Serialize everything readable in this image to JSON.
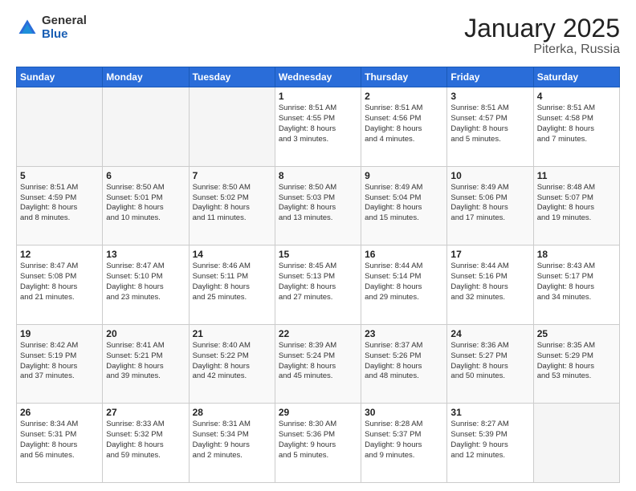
{
  "logo": {
    "general": "General",
    "blue": "Blue"
  },
  "title": {
    "month": "January 2025",
    "location": "Piterka, Russia"
  },
  "weekdays": [
    "Sunday",
    "Monday",
    "Tuesday",
    "Wednesday",
    "Thursday",
    "Friday",
    "Saturday"
  ],
  "weeks": [
    [
      {
        "day": "",
        "info": ""
      },
      {
        "day": "",
        "info": ""
      },
      {
        "day": "",
        "info": ""
      },
      {
        "day": "1",
        "info": "Sunrise: 8:51 AM\nSunset: 4:55 PM\nDaylight: 8 hours\nand 3 minutes."
      },
      {
        "day": "2",
        "info": "Sunrise: 8:51 AM\nSunset: 4:56 PM\nDaylight: 8 hours\nand 4 minutes."
      },
      {
        "day": "3",
        "info": "Sunrise: 8:51 AM\nSunset: 4:57 PM\nDaylight: 8 hours\nand 5 minutes."
      },
      {
        "day": "4",
        "info": "Sunrise: 8:51 AM\nSunset: 4:58 PM\nDaylight: 8 hours\nand 7 minutes."
      }
    ],
    [
      {
        "day": "5",
        "info": "Sunrise: 8:51 AM\nSunset: 4:59 PM\nDaylight: 8 hours\nand 8 minutes."
      },
      {
        "day": "6",
        "info": "Sunrise: 8:50 AM\nSunset: 5:01 PM\nDaylight: 8 hours\nand 10 minutes."
      },
      {
        "day": "7",
        "info": "Sunrise: 8:50 AM\nSunset: 5:02 PM\nDaylight: 8 hours\nand 11 minutes."
      },
      {
        "day": "8",
        "info": "Sunrise: 8:50 AM\nSunset: 5:03 PM\nDaylight: 8 hours\nand 13 minutes."
      },
      {
        "day": "9",
        "info": "Sunrise: 8:49 AM\nSunset: 5:04 PM\nDaylight: 8 hours\nand 15 minutes."
      },
      {
        "day": "10",
        "info": "Sunrise: 8:49 AM\nSunset: 5:06 PM\nDaylight: 8 hours\nand 17 minutes."
      },
      {
        "day": "11",
        "info": "Sunrise: 8:48 AM\nSunset: 5:07 PM\nDaylight: 8 hours\nand 19 minutes."
      }
    ],
    [
      {
        "day": "12",
        "info": "Sunrise: 8:47 AM\nSunset: 5:08 PM\nDaylight: 8 hours\nand 21 minutes."
      },
      {
        "day": "13",
        "info": "Sunrise: 8:47 AM\nSunset: 5:10 PM\nDaylight: 8 hours\nand 23 minutes."
      },
      {
        "day": "14",
        "info": "Sunrise: 8:46 AM\nSunset: 5:11 PM\nDaylight: 8 hours\nand 25 minutes."
      },
      {
        "day": "15",
        "info": "Sunrise: 8:45 AM\nSunset: 5:13 PM\nDaylight: 8 hours\nand 27 minutes."
      },
      {
        "day": "16",
        "info": "Sunrise: 8:44 AM\nSunset: 5:14 PM\nDaylight: 8 hours\nand 29 minutes."
      },
      {
        "day": "17",
        "info": "Sunrise: 8:44 AM\nSunset: 5:16 PM\nDaylight: 8 hours\nand 32 minutes."
      },
      {
        "day": "18",
        "info": "Sunrise: 8:43 AM\nSunset: 5:17 PM\nDaylight: 8 hours\nand 34 minutes."
      }
    ],
    [
      {
        "day": "19",
        "info": "Sunrise: 8:42 AM\nSunset: 5:19 PM\nDaylight: 8 hours\nand 37 minutes."
      },
      {
        "day": "20",
        "info": "Sunrise: 8:41 AM\nSunset: 5:21 PM\nDaylight: 8 hours\nand 39 minutes."
      },
      {
        "day": "21",
        "info": "Sunrise: 8:40 AM\nSunset: 5:22 PM\nDaylight: 8 hours\nand 42 minutes."
      },
      {
        "day": "22",
        "info": "Sunrise: 8:39 AM\nSunset: 5:24 PM\nDaylight: 8 hours\nand 45 minutes."
      },
      {
        "day": "23",
        "info": "Sunrise: 8:37 AM\nSunset: 5:26 PM\nDaylight: 8 hours\nand 48 minutes."
      },
      {
        "day": "24",
        "info": "Sunrise: 8:36 AM\nSunset: 5:27 PM\nDaylight: 8 hours\nand 50 minutes."
      },
      {
        "day": "25",
        "info": "Sunrise: 8:35 AM\nSunset: 5:29 PM\nDaylight: 8 hours\nand 53 minutes."
      }
    ],
    [
      {
        "day": "26",
        "info": "Sunrise: 8:34 AM\nSunset: 5:31 PM\nDaylight: 8 hours\nand 56 minutes."
      },
      {
        "day": "27",
        "info": "Sunrise: 8:33 AM\nSunset: 5:32 PM\nDaylight: 8 hours\nand 59 minutes."
      },
      {
        "day": "28",
        "info": "Sunrise: 8:31 AM\nSunset: 5:34 PM\nDaylight: 9 hours\nand 2 minutes."
      },
      {
        "day": "29",
        "info": "Sunrise: 8:30 AM\nSunset: 5:36 PM\nDaylight: 9 hours\nand 5 minutes."
      },
      {
        "day": "30",
        "info": "Sunrise: 8:28 AM\nSunset: 5:37 PM\nDaylight: 9 hours\nand 9 minutes."
      },
      {
        "day": "31",
        "info": "Sunrise: 8:27 AM\nSunset: 5:39 PM\nDaylight: 9 hours\nand 12 minutes."
      },
      {
        "day": "",
        "info": ""
      }
    ]
  ]
}
